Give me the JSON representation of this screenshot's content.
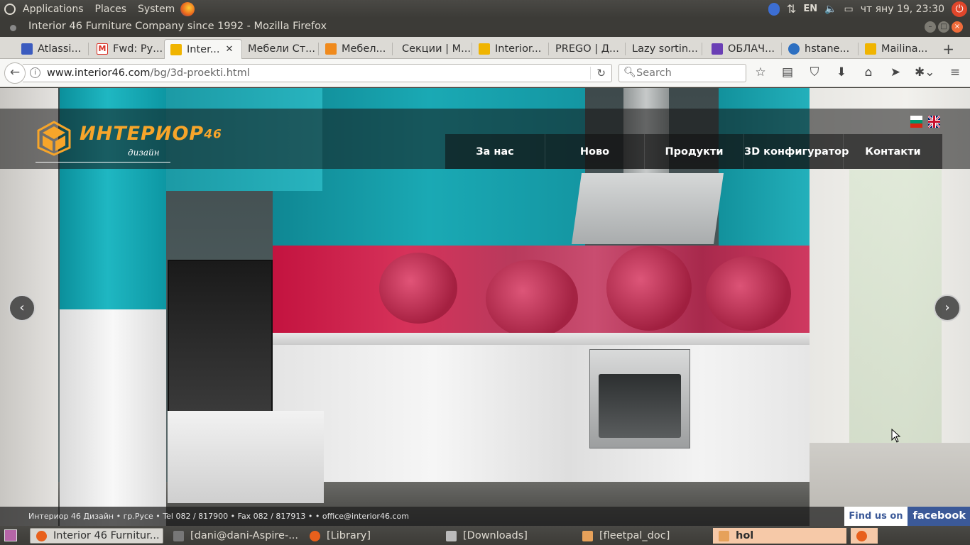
{
  "system_bar": {
    "menus": [
      "Applications",
      "Places",
      "System"
    ],
    "language": "EN",
    "clock": "чт яну 19, 23:30"
  },
  "window": {
    "title": "Interior 46 Furniture Company since 1992 - Mozilla Firefox"
  },
  "tabs": [
    {
      "label": "Atlassi...",
      "icon": "atlassian-icon",
      "color": "#3b5bbf"
    },
    {
      "label": "Fwd: Ру...",
      "icon": "gmail-icon",
      "color": "#d93025"
    },
    {
      "label": "Inter...",
      "icon": "interior46-icon",
      "color": "#f0b400",
      "active": true
    },
    {
      "label": "Мебели Ст...",
      "icon": "page-icon",
      "color": "#dcdad5"
    },
    {
      "label": "Мебел...",
      "icon": "orange-logo-icon",
      "color": "#f08a1c"
    },
    {
      "label": "Секции | М...",
      "icon": "page-icon",
      "color": "#dcdad5"
    },
    {
      "label": "Interior...",
      "icon": "interior46-icon",
      "color": "#f0b400"
    },
    {
      "label": "PREGO | Д...",
      "icon": "page-icon",
      "color": "#dcdad5"
    },
    {
      "label": "Lazy sortin...",
      "icon": "page-icon",
      "color": "#dcdad5"
    },
    {
      "label": "ОБЛАЧ...",
      "icon": "purple-list-icon",
      "color": "#6a3fb5"
    },
    {
      "label": "hstane...",
      "icon": "blue-circle-icon",
      "color": "#2d6fc1"
    },
    {
      "label": "Mailina...",
      "icon": "mail-icon",
      "color": "#f0b400"
    }
  ],
  "navbar": {
    "url_host": "www.interior46.com",
    "url_path": "/bg/3d-proekti.html",
    "search_placeholder": "Search"
  },
  "site": {
    "logo_text": "ИНТЕРИОР",
    "logo_number": "46",
    "logo_subtitle": "дизайн",
    "nav": [
      "За нас",
      "Ново",
      "Продукти",
      "3D конфигуратор",
      "Контакти"
    ],
    "footer_info": "Интериор 46 Дизайн • гр.Русе • Tel 082 / 817900 • Fax 082 / 817913 • • office@interior46.com",
    "facebook_find": "Find us on",
    "facebook_brand": "facebook",
    "prev_arrow": "‹",
    "next_arrow": "›"
  },
  "taskbar": [
    {
      "label": "Interior 46 Furnitur...",
      "icon": "firefox-icon",
      "state": "current"
    },
    {
      "label": "[dani@dani-Aspire-...",
      "icon": "terminal-icon",
      "state": "normal"
    },
    {
      "label": "[Library]",
      "icon": "firefox-icon",
      "state": "normal"
    },
    {
      "label": "[Downloads]",
      "icon": "downloads-icon",
      "state": "normal"
    },
    {
      "label": "[fleetpal_doc]",
      "icon": "folder-icon",
      "state": "normal"
    },
    {
      "label": "hol",
      "icon": "folder-icon",
      "state": "highlighted"
    }
  ],
  "colors": {
    "brand_orange": "#f7a52a",
    "facebook_blue": "#3b5998",
    "firefox_orange": "#e8601c"
  }
}
